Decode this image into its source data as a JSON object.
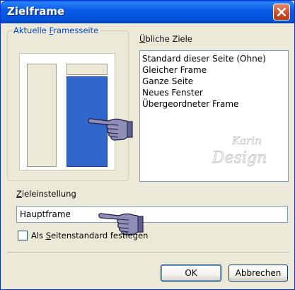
{
  "window": {
    "title": "Zielframe",
    "titlebar_color": "#0451d8",
    "close_color": "#cf4a25"
  },
  "frames_group": {
    "label_pre": "Aktuelle ",
    "label_key": "F",
    "label_post": "ramesseite",
    "label_color": "#0046d5",
    "selected_frame_color": "#3166cb"
  },
  "targets": {
    "label_key": "Ü",
    "label_post": "bliche Ziele",
    "items": [
      "Standard dieser Seite (Ohne)",
      "Gleicher Frame",
      "Ganze Seite",
      "Neues Fenster",
      "Übergeordneter Frame"
    ]
  },
  "target_setting": {
    "label_key": "Z",
    "label_post": "ieleinstellung",
    "value": "Hauptframe"
  },
  "default_checkbox": {
    "label_pre": "Als ",
    "label_key": "S",
    "label_post": "eitenstandard festlegen",
    "checked": false
  },
  "buttons": {
    "ok": "OK",
    "cancel": "Abbrechen"
  },
  "watermark": {
    "line1": "Karin",
    "line2": "Design"
  },
  "icons": [
    "close-icon",
    "pointing-hand-icon"
  ]
}
